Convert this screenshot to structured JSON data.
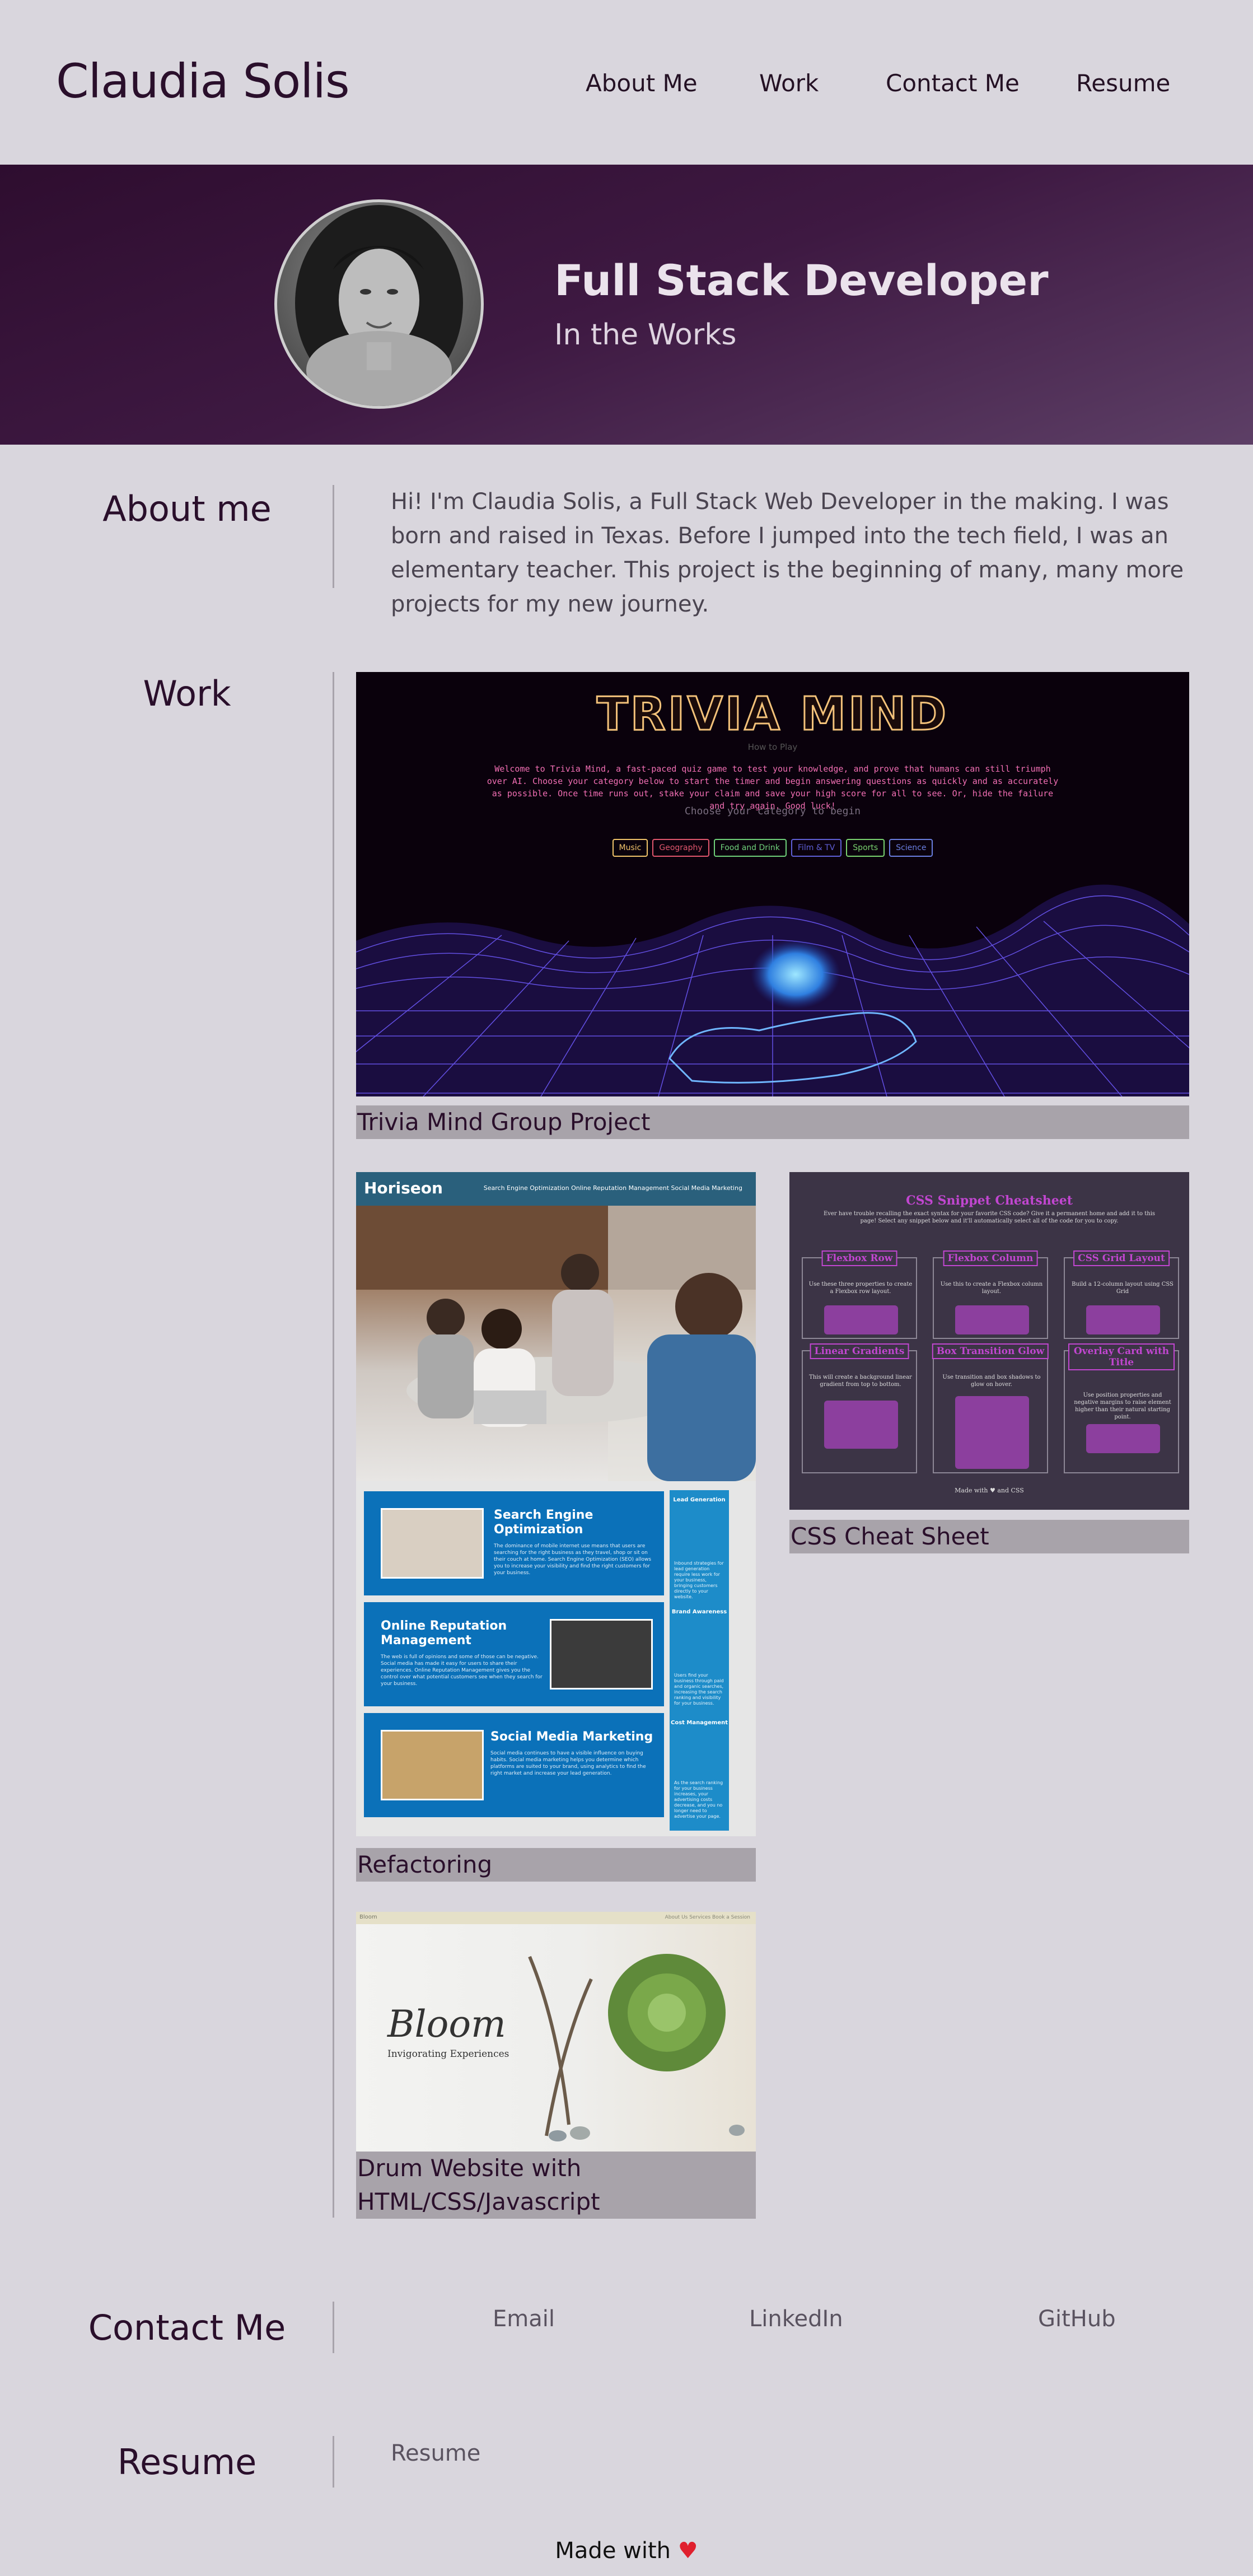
{
  "header": {
    "brand": "Claudia Solis",
    "nav": [
      {
        "label": "About Me"
      },
      {
        "label": "Work"
      },
      {
        "label": "Contact Me"
      },
      {
        "label": "Resume"
      }
    ]
  },
  "hero": {
    "title": "Full Stack Developer",
    "subtitle": "In the Works"
  },
  "about": {
    "heading": "About me",
    "text": "Hi! I'm Claudia Solis, a Full Stack Web Developer in the making. I was born and raised in Texas. Before I jumped into the tech field, I was an elementary teacher. This project is the beginning of many, many more projects for my new journey."
  },
  "work": {
    "heading": "Work",
    "projects": [
      {
        "caption": "Trivia Mind Group Project"
      },
      {
        "caption": "Refactoring"
      },
      {
        "caption": "CSS Cheat Sheet"
      },
      {
        "caption": "Drum Website with HTML/CSS/Javascript"
      }
    ],
    "trivia_preview": {
      "title": "TRIVIA MIND",
      "how_to_play": "How to Play",
      "description": "Welcome to Trivia Mind, a fast-paced quiz game to test your knowledge, and prove that humans can still triumph over AI. Choose your category below to start the timer and begin answering questions as quickly and as accurately as possible. Once time runs out, stake your claim and save your high score for all to see. Or, hide the failure and try again. Good luck!",
      "choose": "Choose your category to begin",
      "categories": [
        {
          "label": "Music",
          "color": "#f0c36a"
        },
        {
          "label": "Geography",
          "color": "#e0566d"
        },
        {
          "label": "Food and Drink",
          "color": "#6fd17a"
        },
        {
          "label": "Film & TV",
          "color": "#5f5fd6"
        },
        {
          "label": "Sports",
          "color": "#7ad46f"
        },
        {
          "label": "Science",
          "color": "#6a7ee0"
        }
      ]
    },
    "horiseon_preview": {
      "logo": "Horiseon",
      "links": "Search Engine Optimization     Online Reputation Management     Social Media Marketing",
      "cards": [
        {
          "title": "Search Engine Optimization",
          "text": "The dominance of mobile internet use means that users are searching for the right business as they travel, shop or sit on their couch at home. Search Engine Optimization (SEO) allows you to increase your visibility and find the right customers for your business."
        },
        {
          "title": "Online Reputation Management",
          "text": "The web is full of opinions and some of those can be negative. Social media has made it easy for users to share their experiences. Online Reputation Management gives you the control over what potential customers see when they search for your business."
        },
        {
          "title": "Social Media Marketing",
          "text": "Social media continues to have a visible influence on buying habits. Social media marketing helps you determine which platforms are suited to your brand, using analytics to find the right market and increase your lead generation."
        }
      ],
      "side": [
        {
          "title": "Lead Generation",
          "text": "Inbound strategies for lead generation require less work for your business, bringing customers directly to your website."
        },
        {
          "title": "Brand Awareness",
          "text": "Users find your business through paid and organic searches, increasing the search ranking and visibility for your business."
        },
        {
          "title": "Cost Management",
          "text": "As the search ranking for your business increases, your advertising costs decrease, and you no longer need to advertise your page."
        }
      ]
    },
    "cheat_preview": {
      "title": "CSS Snippet Cheatsheet",
      "subtitle": "Ever have trouble recalling the exact syntax for your favorite CSS code? Give it a permanent home and add it to this page! Select any snippet below and it'll automatically select all of the code for you to copy.",
      "cards": [
        {
          "title": "Flexbox Row",
          "text": "Use these three properties to create a Flexbox row layout."
        },
        {
          "title": "Flexbox Column",
          "text": "Use this to create a Flexbox column layout."
        },
        {
          "title": "CSS Grid Layout",
          "text": "Build a 12-column layout using CSS Grid"
        },
        {
          "title": "Linear Gradients",
          "text": "This will create a background linear gradient from top to bottom."
        },
        {
          "title": "Box Transition Glow",
          "text": "Use transition and box shadows to glow on hover."
        },
        {
          "title": "Overlay Card with Title",
          "text": "Use position properties and negative margins to raise element higher than their natural starting point."
        }
      ],
      "footer": "Made with ♥ and CSS"
    },
    "bloom_preview": {
      "logo": "Bloom",
      "links": "About Us    Services    Book a Session",
      "title": "Bloom",
      "subtitle": "Invigorating Experiences"
    }
  },
  "contact": {
    "heading": "Contact Me",
    "links": [
      {
        "label": "Email"
      },
      {
        "label": "LinkedIn"
      },
      {
        "label": "GitHub"
      }
    ]
  },
  "resume": {
    "heading": "Resume",
    "link": "Resume"
  },
  "footer": {
    "text": "Made with",
    "heart": "♥"
  },
  "colors": {
    "page_bg": "#d9d6dd",
    "accent": "#2a0f2b",
    "caption_bg": "#a8a3aa"
  }
}
